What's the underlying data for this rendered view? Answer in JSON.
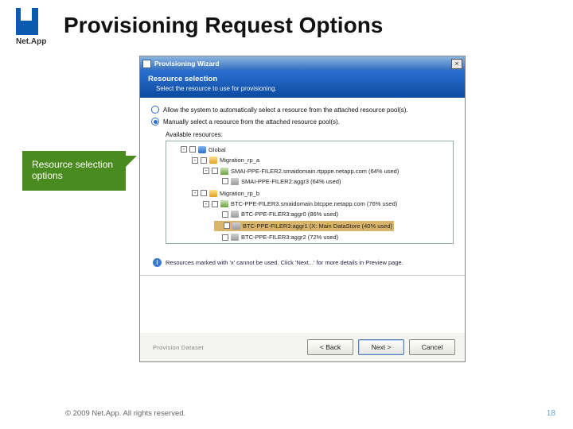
{
  "slide": {
    "title": "Provisioning Request Options",
    "footer": "© 2009 Net.App.  All rights reserved.",
    "page": "18"
  },
  "logo": {
    "text": "Net.App"
  },
  "callout": {
    "text": "Resource selection options"
  },
  "dialog": {
    "title": "Provisioning Wizard",
    "banner": {
      "title": "Resource selection",
      "sub": "Select the resource to use for provisioning."
    },
    "radio": {
      "auto": "Allow the system to automatically select a resource from the attached resource pool(s).",
      "manual": "Manually select a resource from the attached resource pool(s)."
    },
    "avail_label": "Available resources:",
    "tree": {
      "root": "Global",
      "rp_a": "Migration_rp_a",
      "rp_a_filer": "SMAI-PPE-FILER2.smaidomain.rtpppe.netapp.com (64% used)",
      "rp_a_aggr": "SMAI-PPE-FILER2:aggr3 (64% used)",
      "rp_b": "Migration_rp_b",
      "rp_b_filer": "BTC-PPE-FILER3.smaidomain.btcppe.netapp.com (76% used)",
      "rp_b_aggr0": "BTC-PPE-FILER3:aggr0 (86% used)",
      "rp_b_aggr1": "BTC-PPE-FILER3:aggr1 (X: Main DataStore (40% used)",
      "rp_b_aggr2": "BTC-PPE-FILER3:aggr2 (72% used)"
    },
    "info": "Resources marked with 'x' cannot be used. Click 'Next...' for more details in Preview page.",
    "footer_note": "Provision Dataset",
    "buttons": {
      "back": "< Back",
      "next": "Next >",
      "cancel": "Cancel"
    }
  }
}
